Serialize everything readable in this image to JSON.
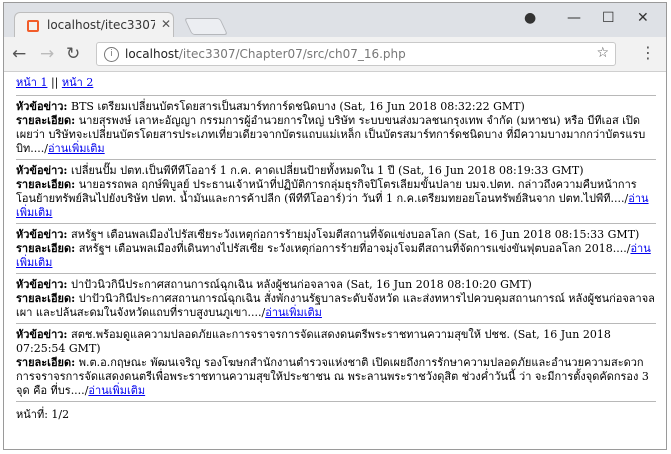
{
  "browser": {
    "tab_title": "localhost/itec3307/Chapt",
    "url_host": "localhost",
    "url_path": "/itec3307/Chapter07/src/ch07_16.php"
  },
  "pagination": {
    "page1": "หน้า 1",
    "separator": "||",
    "page2": "หน้า 2"
  },
  "labels": {
    "headline": "หัวข้อข่าว:",
    "detail": "รายละเอียด:",
    "more": "อ่านเพิ่มเติม"
  },
  "news": [
    {
      "headline": " BTS เตรียมเปลี่ยนบัตรโดยสารเป็นสมาร์ทการ์ดชนิดบาง (Sat, 16 Jun 2018 08:32:22 GMT)",
      "detail": " นายสุรพงษ์ เลาหะอัญญา กรรมการผู้อำนวยการใหญ่ บริษัท ระบบขนส่งมวลชนกรุงเทพ จำกัด (มหาชน) หรือ บีทีเอส เปิดเผยว่า บริษัทจะเปลี่ยนบัตรโดยสารประเภทเที่ยวเดียวจากบัตรแถบแม่เหล็ก เป็นบัตรสมาร์ทการ์ดชนิดบาง ที่มีความบางมากกว่าบัตรแรบบิท....",
      "more_prefix": "/"
    },
    {
      "headline": " เปลี่ยนปั๊ม ปตท.เป็นพีทีทีโออาร์ 1 ก.ค. คาดเปลี่ยนป้ายทั้งหมดใน 1 ปี (Sat, 16 Jun 2018 08:19:33 GMT)",
      "detail": " นายอรรถพล ฤกษ์พิบูลย์ ประธานเจ้าหน้าที่ปฏิบัติการกลุ่มธุรกิจปิโตรเลียมขั้นปลาย บมจ.ปตท. กล่าวถึงความคืบหน้าการโอนย้ายทรัพย์สินไปยังบริษัท ปตท. น้ำมันและการค้าปลีก (พีทีทีโออาร์)ว่า วันที่ 1 ก.ค.เตรียมทยอยโอนทรัพย์สินจาก ปตท.ไปพีที....",
      "more_prefix": "/"
    },
    {
      "headline": " สหรัฐฯ เตือนพลเมืองไปรัสเซียระวังเหตุก่อการร้ายมุ่งโจมตีสถานที่จัดแข่งบอลโลก (Sat, 16 Jun 2018 08:15:33 GMT)",
      "detail": " สหรัฐฯ เตือนพลเมืองที่เดินทางไปรัสเซีย ระวังเหตุก่อการร้ายที่อาจมุ่งโจมตีสถานที่จัดการแข่งขันฟุตบอลโลก 2018....",
      "more_prefix": "/"
    },
    {
      "headline": " ปาปัวนิวกินีประกาศสถานการณ์ฉุกเฉิน หลังผู้ชนก่อจลาจล (Sat, 16 Jun 2018 08:10:20 GMT)",
      "detail": " ปาปัวนิวกินีประกาศสถานการณ์ฉุกเฉิน สั่งพักงานรัฐบาลระดับจังหวัด และส่งทหารไปควบคุมสถานการณ์ หลังผู้ชนก่อจลาจลเผา และปล้นสะดมในจังหวัดแถบที่ราบสูงบนภูเขา....",
      "more_prefix": "/"
    },
    {
      "headline": " สตช.พร้อมดูแลความปลอดภัยและการจราจรการจัดแสดงดนตรีพระราชทานความสุขให้ ปชช. (Sat, 16 Jun 2018 07:25:54 GMT)",
      "detail": " พ.ต.อ.กฤษณะ พัฒนเจริญ รองโฆษกสำนักงานตำรวจแห่งชาติ เปิดเผยถึงการรักษาความปลอดภัยและอำนวยความสะดวกการจราจรการจัดแสดงดนตรีเพื่อพระราชทานความสุขให้ประชาชน ณ พระลานพระราชวังดุสิต ช่วงค่ำวันนี้ ว่า จะมีการตั้งจุดคัดกรอง 3 จุด คือ ที่บร....",
      "more_prefix": "/"
    }
  ],
  "footer": {
    "page_indicator": "หน้าที่: 1/2"
  }
}
